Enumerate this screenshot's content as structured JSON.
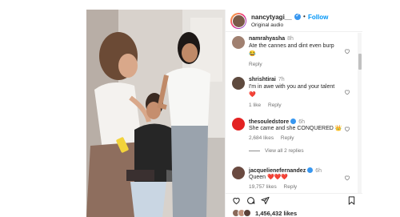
{
  "post": {
    "username": "nancytyagi__",
    "follow_label": "Follow",
    "separator": "•",
    "audio_label": "Original audio",
    "likes_count": "1,456,432 likes"
  },
  "comments": [
    {
      "username": "namrahyasha",
      "time": "8h",
      "text": "Ate the cannes and dint even burp",
      "emoji": "😂",
      "reply_label": "Reply"
    },
    {
      "username": "shrishtirai",
      "time": "7h",
      "text": "I'm in awe with you and your talent",
      "emoji": "❤️",
      "likes": "1 like",
      "reply_label": "Reply"
    },
    {
      "username": "thesouledstore",
      "time": "6h",
      "text": "She came and she CONQUERED",
      "emoji": "👑",
      "likes": "2,684 likes",
      "reply_label": "Reply",
      "view_replies": "View all 2 replies",
      "verified": true
    },
    {
      "username": "jacquelienefernandez",
      "time": "6h",
      "text": "Queen",
      "emoji": "❤️❤️❤️",
      "likes": "19,757 likes",
      "reply_label": "Reply",
      "verified": true
    }
  ],
  "icons": [
    "verified-icon",
    "heart-icon",
    "comment-icon",
    "share-icon",
    "bookmark-icon"
  ],
  "colors": {
    "link_blue": "#0095f6",
    "verified_blue": "#3897f0",
    "heart_red": "#ed4956"
  }
}
